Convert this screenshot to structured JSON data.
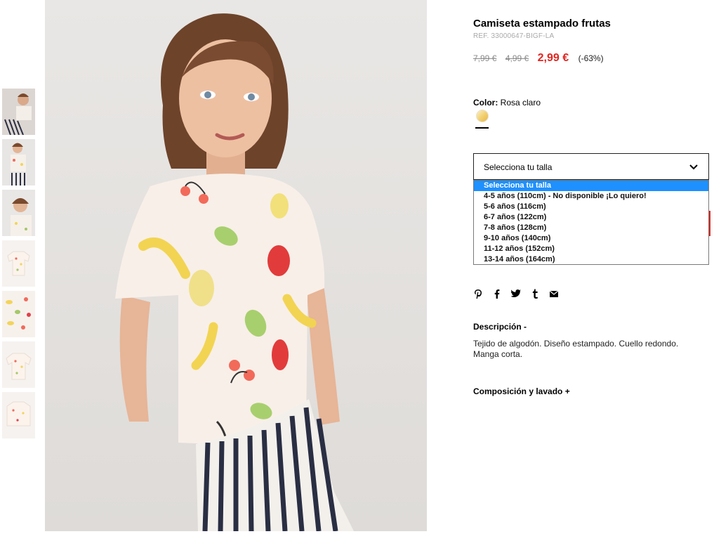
{
  "product": {
    "title": "Camiseta estampado frutas",
    "ref": "REF. 33000647-BIGF-LA",
    "price_original": "7,99 €",
    "price_previous": "4,99 €",
    "price_current": "2,99 €",
    "discount": "(-63%)"
  },
  "color": {
    "label": "Color:",
    "value": "Rosa claro",
    "swatch_color": "#f1cf6d"
  },
  "size_select": {
    "placeholder": "Selecciona tu talla",
    "options": [
      "Selecciona tu talla",
      "4-5 años (110cm) - No disponible ¡Lo quiero!",
      "5-6 años (116cm)",
      "6-7 años (122cm)",
      "7-8 años (128cm)",
      "9-10 años (140cm)",
      "11-12 años (152cm)",
      "13-14 años (164cm)"
    ],
    "highlight_color": "#1e90ff"
  },
  "share_icons": [
    "pinterest-icon",
    "facebook-icon",
    "twitter-icon",
    "tumblr-icon",
    "email-icon"
  ],
  "description": {
    "title": "Descripción  -",
    "text": "Tejido de algodón. Diseño estampado. Cuello redondo. Manga corta."
  },
  "composition": {
    "title": "Composición y lavado  +"
  },
  "colors": {
    "sale_red": "#e2251f",
    "text": "#000000",
    "muted": "#a9a9a9"
  }
}
